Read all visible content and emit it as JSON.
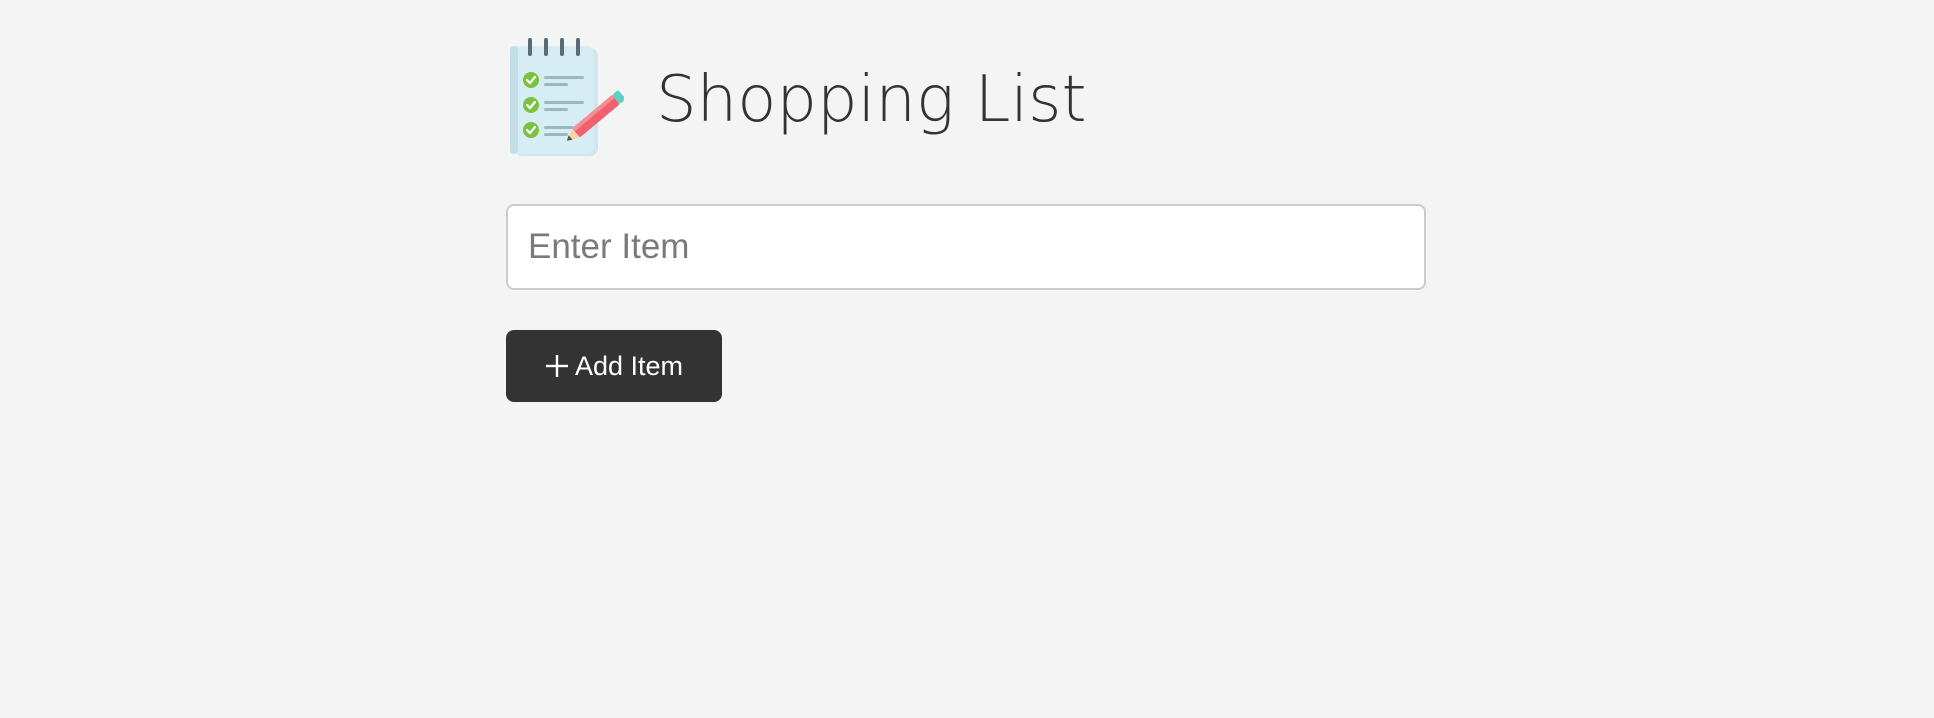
{
  "header": {
    "title": "Shopping List",
    "logo_icon": "notepad-checklist-icon"
  },
  "form": {
    "input_placeholder": "Enter Item",
    "input_value": "",
    "add_button_label": "Add Item",
    "add_button_icon": "plus-icon"
  },
  "items": [],
  "colors": {
    "background": "#f4f4f4",
    "button": "#333333",
    "title": "#333333",
    "input_border": "#cccccc",
    "check_green": "#7cc242",
    "pencil_red": "#f0616d",
    "notepad_blue": "#d4ecf3"
  }
}
